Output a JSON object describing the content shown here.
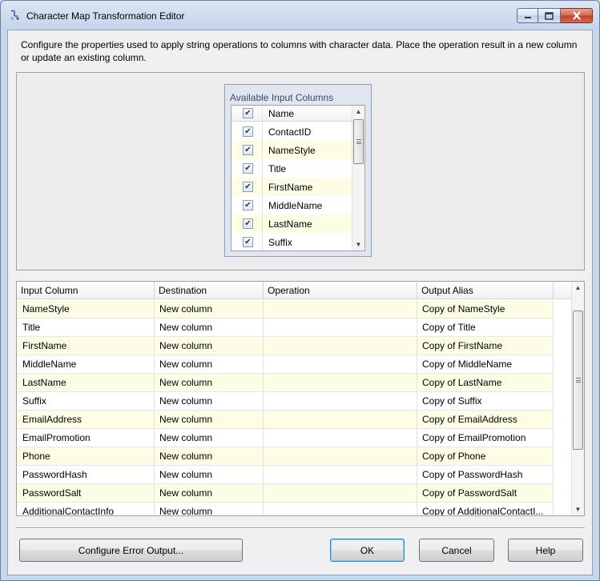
{
  "window": {
    "title": "Character Map Transformation Editor"
  },
  "description": "Configure the properties used to apply string operations to columns with character data. Place the operation result in a new column or update an existing column.",
  "available_columns": {
    "title": "Available Input Columns",
    "header": "Name",
    "items": [
      {
        "name": "ContactID",
        "checked": true
      },
      {
        "name": "NameStyle",
        "checked": true
      },
      {
        "name": "Title",
        "checked": true
      },
      {
        "name": "FirstName",
        "checked": true
      },
      {
        "name": "MiddleName",
        "checked": true
      },
      {
        "name": "LastName",
        "checked": true
      },
      {
        "name": "Suffix",
        "checked": true
      }
    ]
  },
  "grid": {
    "headers": [
      "Input Column",
      "Destination",
      "Operation",
      "Output Alias"
    ],
    "rows": [
      [
        "NameStyle",
        "New column",
        "",
        "Copy of NameStyle"
      ],
      [
        "Title",
        "New column",
        "",
        "Copy of Title"
      ],
      [
        "FirstName",
        "New column",
        "",
        "Copy of FirstName"
      ],
      [
        "MiddleName",
        "New column",
        "",
        "Copy of MiddleName"
      ],
      [
        "LastName",
        "New column",
        "",
        "Copy of LastName"
      ],
      [
        "Suffix",
        "New column",
        "",
        "Copy of Suffix"
      ],
      [
        "EmailAddress",
        "New column",
        "",
        "Copy of EmailAddress"
      ],
      [
        "EmailPromotion",
        "New column",
        "",
        "Copy of EmailPromotion"
      ],
      [
        "Phone",
        "New column",
        "",
        "Copy of Phone"
      ],
      [
        "PasswordHash",
        "New column",
        "",
        "Copy of PasswordHash"
      ],
      [
        "PasswordSalt",
        "New column",
        "",
        "Copy of PasswordSalt"
      ],
      [
        "AdditionalContactInfo",
        "New column",
        "",
        "Copy of AdditionalContactI..."
      ]
    ]
  },
  "buttons": {
    "configure_error": "Configure Error Output...",
    "ok": "OK",
    "cancel": "Cancel",
    "help": "Help"
  },
  "icons": {
    "app": "character-map-icon",
    "minimize": "minimize-icon",
    "maximize": "maximize-icon",
    "close": "close-icon"
  },
  "colors": {
    "alt_row": "#fdfde6",
    "close_button": "#c2432a"
  }
}
